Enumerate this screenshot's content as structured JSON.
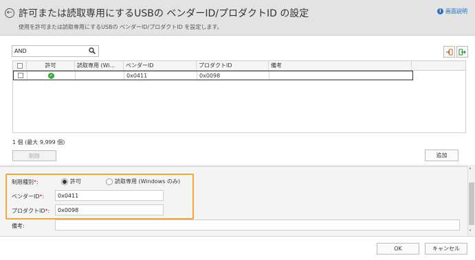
{
  "header": {
    "title": "許可または読取専用にするUSBの ベンダーID/プロダクトID の設定",
    "subtitle": "使用を許可または読取専用にするUSBの ベンダーID/プロダクトID を設定します。",
    "help_label": "画面説明",
    "back_icon": "back-arrow-circle-icon",
    "help_icon": "info-icon"
  },
  "toolbar": {
    "search_value": "AND",
    "search_icon": "search-icon",
    "import_icon": "import-icon",
    "export_icon": "export-icon"
  },
  "table": {
    "columns": [
      "許可",
      "読取専用 (Wi...",
      "ベンダーID",
      "プロダクトID",
      "備考"
    ],
    "rows": [
      {
        "allow_icon": "green-check-icon",
        "read_only": "",
        "vendor_id": "0x0411",
        "product_id": "0x0098",
        "note": ""
      }
    ]
  },
  "summary": {
    "count_text": "1 個 (最大 9,999 個)",
    "delete_label": "削除",
    "add_label": "追加"
  },
  "form": {
    "restriction_label": "制限種別",
    "required_mark": "*",
    "colon": ":",
    "option_allow": "許可",
    "option_readonly": "読取専用 (Windows のみ)",
    "selected_option": "許可",
    "vendor_label": "ベンダーID",
    "vendor_value": "0x0411",
    "product_label": "プロダクトID",
    "product_value": "0x0098",
    "note_label": "備考:",
    "note_value": ""
  },
  "footer": {
    "ok_label": "OK",
    "cancel_label": "キャンセル"
  },
  "colors": {
    "highlight": "#f0a733",
    "required": "#d02020",
    "link": "#2a6ebb",
    "check": "#3aa83a"
  }
}
